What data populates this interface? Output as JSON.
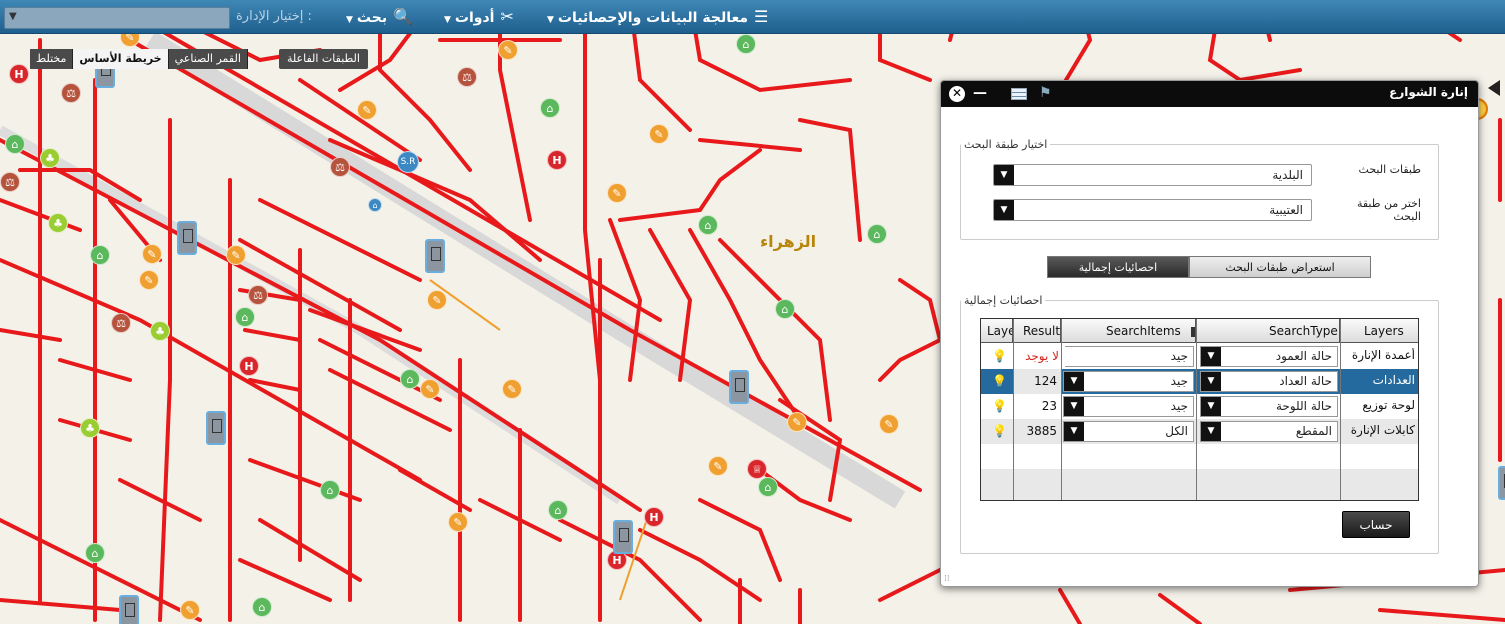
{
  "topbar": {
    "admin_label": "إختيار الإدارة :",
    "search_label": "بحث",
    "tools_label": "أدوات",
    "data_label": "معالجة البيانات والإحصائيات"
  },
  "basemap": {
    "mixed": "مختلط",
    "base": "خريطة الأساس",
    "satellite": "القمر الصناعي",
    "active_layers": "الطبقات الفاعلة"
  },
  "map": {
    "district_label": "الزهراء"
  },
  "panel": {
    "title": "إنارة الشوارع",
    "search_legend": "اختيار طبقة البحث",
    "search_layers_label": "طبقات البحث",
    "search_layers_value": "البلدية",
    "choose_layer_label": "اختر من طبقة البحث",
    "choose_layer_value": "العتيبية",
    "tab_browse": "استعراض طبقات البحث",
    "tab_stats": "احصائيات إجمالية",
    "stats_legend": "احصائيات إجمالية",
    "calc_button": "حساب"
  },
  "grid": {
    "headers": {
      "layers": "Layers",
      "search_type": "SearchType",
      "search_items": "SearchItems",
      "result": "Result",
      "layer": "Laye"
    },
    "rows": [
      {
        "layer": "أعمدة الإنارة",
        "type": "حالة العمود",
        "item": "جيد",
        "result": "لا يوجد"
      },
      {
        "layer": "العدادات",
        "type": "حالة العداد",
        "item": "جيد",
        "result": "124"
      },
      {
        "layer": "لوحة توزيع",
        "type": "حالة اللوحة",
        "item": "جيد",
        "result": "23"
      },
      {
        "layer": "كابلات الإنارة",
        "type": "المقطع",
        "item": "الكل",
        "result": "3885"
      }
    ]
  },
  "colors": {
    "road": "#e8191b",
    "topbar": "#2f73a3",
    "selected_row": "#256a9e",
    "result_none": "#d7261e"
  }
}
